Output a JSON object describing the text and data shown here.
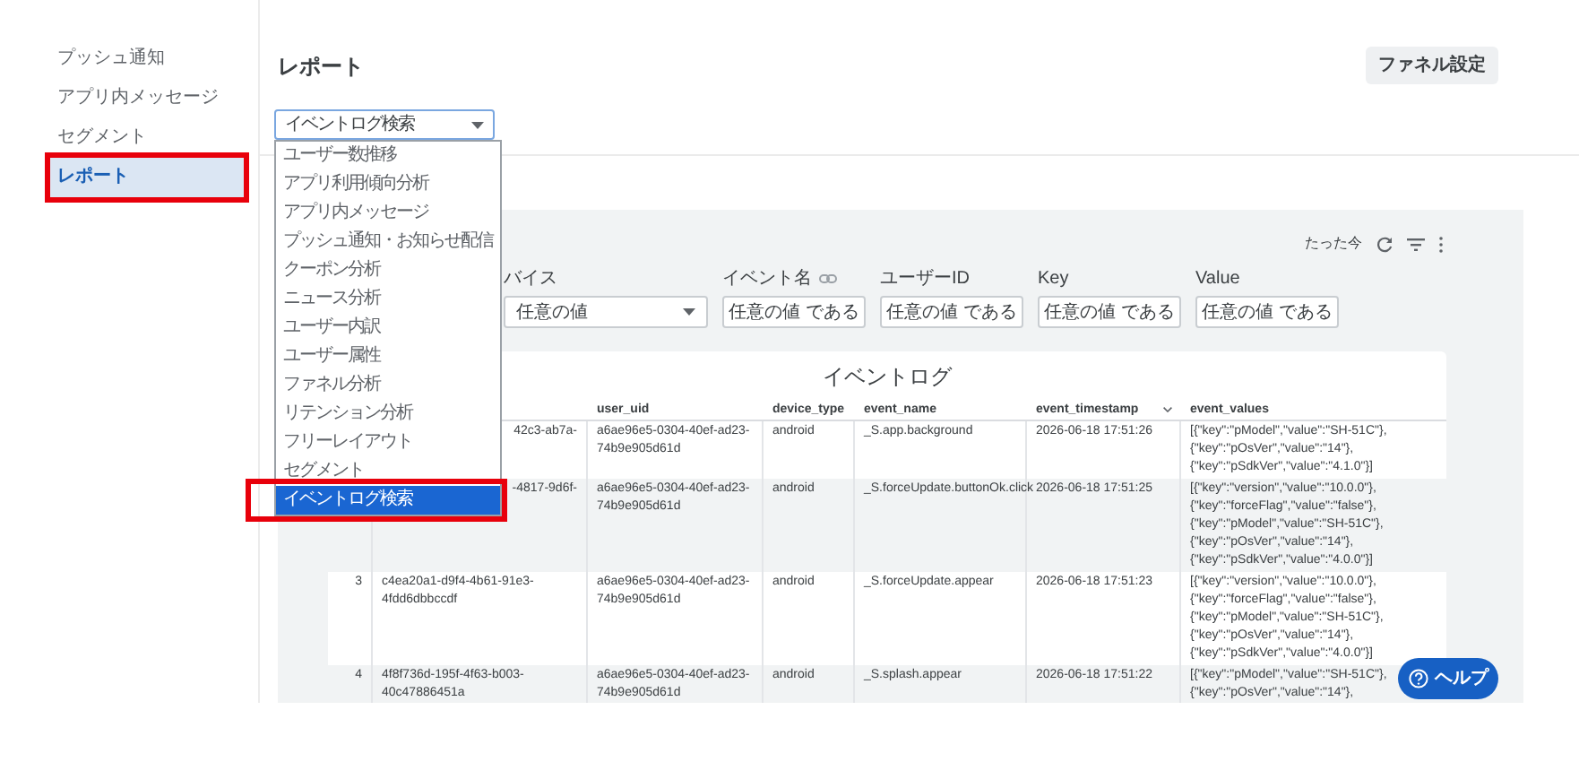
{
  "sidebar": {
    "items": [
      {
        "label": "プッシュ通知",
        "selected": false,
        "highlighted": false
      },
      {
        "label": "アプリ内メッセージ",
        "selected": false,
        "highlighted": false
      },
      {
        "label": "セグメント",
        "selected": false,
        "highlighted": false
      },
      {
        "label": "レポート",
        "selected": true,
        "highlighted": true
      }
    ]
  },
  "page_title": "レポート",
  "funnel_button": "ファネル設定",
  "report_select": {
    "value": "イベントログ検索",
    "expanded": true,
    "options": [
      {
        "label": "ユーザー数推移",
        "selected": false,
        "highlighted": false
      },
      {
        "label": "アプリ利用傾向分析",
        "selected": false,
        "highlighted": false
      },
      {
        "label": "アプリ内メッセージ",
        "selected": false,
        "highlighted": false
      },
      {
        "label": "プッシュ通知・お知らせ配信",
        "selected": false,
        "highlighted": false
      },
      {
        "label": "クーポン分析",
        "selected": false,
        "highlighted": false
      },
      {
        "label": "ニュース分析",
        "selected": false,
        "highlighted": false
      },
      {
        "label": "ユーザー内訳",
        "selected": false,
        "highlighted": false
      },
      {
        "label": "ユーザー属性",
        "selected": false,
        "highlighted": false
      },
      {
        "label": "ファネル分析",
        "selected": false,
        "highlighted": false
      },
      {
        "label": "リテンション分析",
        "selected": false,
        "highlighted": false
      },
      {
        "label": "フリーレイアウト",
        "selected": false,
        "highlighted": false
      },
      {
        "label": "セグメント",
        "selected": false,
        "highlighted": false
      },
      {
        "label": "イベントログ検索",
        "selected": true,
        "highlighted": true
      }
    ]
  },
  "panel": {
    "updated": "たった今",
    "filters": [
      {
        "label": "バイス",
        "kind": "select",
        "value": "任意の値",
        "link_icon": false
      },
      {
        "label": "イベント名",
        "kind": "text",
        "value": "任意の値 である",
        "link_icon": true
      },
      {
        "label": "ユーザーID",
        "kind": "text",
        "value": "任意の値 である",
        "link_icon": false
      },
      {
        "label": "Key",
        "kind": "text",
        "value": "任意の値 である",
        "link_icon": false
      },
      {
        "label": "Value",
        "kind": "text",
        "value": "任意の値 である",
        "link_icon": false
      }
    ],
    "table": {
      "title": "イベントログ",
      "columns": [
        {
          "label": "user_uid",
          "sorted": false
        },
        {
          "label": "device_type",
          "sorted": false
        },
        {
          "label": "event_name",
          "sorted": false
        },
        {
          "label": "event_timestamp",
          "sorted": true
        },
        {
          "label": "event_values",
          "sorted": false
        }
      ],
      "rows": [
        {
          "event_id": [
            "42c3-ab7a-"
          ],
          "user_uid": [
            "a6ae96e5-0304-40ef-ad23-",
            "74b9e905d61d"
          ],
          "device_type": "android",
          "event_name": "_S.app.background",
          "event_timestamp": "2026-06-18 17:51:26",
          "event_values": [
            "[{\"key\":\"pModel\",\"value\":\"SH-51C\"},",
            "{\"key\":\"pOsVer\",\"value\":\"14\"},",
            "{\"key\":\"pSdkVer\",\"value\":\"4.1.0\"}]"
          ]
        },
        {
          "event_id": [
            "-4817-9d6f-"
          ],
          "user_uid": [
            "a6ae96e5-0304-40ef-ad23-",
            "74b9e905d61d"
          ],
          "device_type": "android",
          "event_name": "_S.forceUpdate.buttonOk.click",
          "event_timestamp": "2026-06-18 17:51:25",
          "event_values": [
            "[{\"key\":\"version\",\"value\":\"10.0.0\"},",
            "{\"key\":\"forceFlag\",\"value\":\"false\"},",
            "{\"key\":\"pModel\",\"value\":\"SH-51C\"},",
            "{\"key\":\"pOsVer\",\"value\":\"14\"},",
            "{\"key\":\"pSdkVer\",\"value\":\"4.0.0\"}]"
          ]
        },
        {
          "number": "3",
          "event_id": [
            "c4ea20a1-d9f4-4b61-91e3-",
            "4fdd6dbbccdf"
          ],
          "user_uid": [
            "a6ae96e5-0304-40ef-ad23-",
            "74b9e905d61d"
          ],
          "device_type": "android",
          "event_name": "_S.forceUpdate.appear",
          "event_timestamp": "2026-06-18 17:51:23",
          "event_values": [
            "[{\"key\":\"version\",\"value\":\"10.0.0\"},",
            "{\"key\":\"forceFlag\",\"value\":\"false\"},",
            "{\"key\":\"pModel\",\"value\":\"SH-51C\"},",
            "{\"key\":\"pOsVer\",\"value\":\"14\"},",
            "{\"key\":\"pSdkVer\",\"value\":\"4.0.0\"}]"
          ]
        },
        {
          "number": "4",
          "event_id": [
            "4f8f736d-195f-4f63-b003-",
            "40c47886451a"
          ],
          "user_uid": [
            "a6ae96e5-0304-40ef-ad23-",
            "74b9e905d61d"
          ],
          "device_type": "android",
          "event_name": "_S.splash.appear",
          "event_timestamp": "2026-06-18 17:51:22",
          "event_values": [
            "[{\"key\":\"pModel\",\"value\":\"SH-51C\"},",
            "{\"key\":\"pOsVer\",\"value\":\"14\"},"
          ]
        }
      ]
    }
  },
  "help_button": "ヘルプ"
}
